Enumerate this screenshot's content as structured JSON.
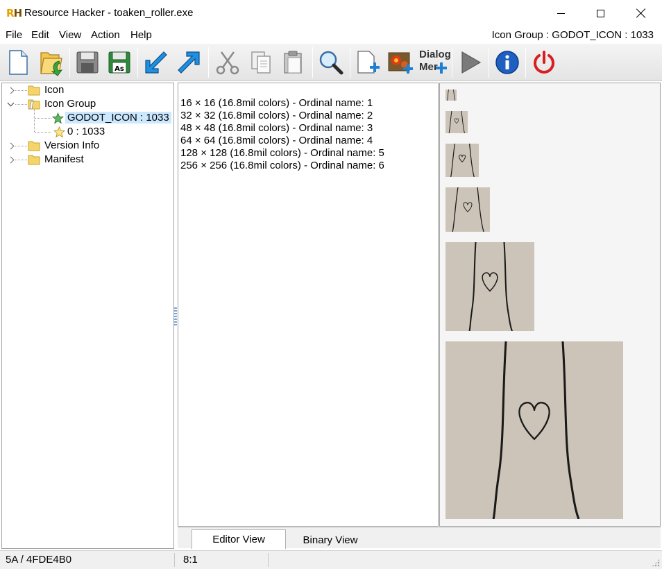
{
  "window": {
    "logo_text": "RH",
    "title": "Resource Hacker - toaken_roller.exe"
  },
  "menu": {
    "items": [
      "File",
      "Edit",
      "View",
      "Action",
      "Help"
    ],
    "status": "Icon Group : GODOT_ICON : 1033"
  },
  "toolbar": {
    "dialog_menu_label_1": "Dialog",
    "dialog_menu_label_2": "Mer"
  },
  "tree": {
    "nodes": [
      {
        "label": "Icon",
        "expanded": false
      },
      {
        "label": "Icon Group",
        "expanded": true
      },
      {
        "label": "GODOT_ICON : 1033",
        "selected": true
      },
      {
        "label": "0 : 1033"
      },
      {
        "label": "Version Info",
        "expanded": false
      },
      {
        "label": "Manifest",
        "expanded": false
      }
    ]
  },
  "resources": {
    "lines": [
      "16 × 16 (16.8mil colors) - Ordinal name: 1",
      "32 × 32 (16.8mil colors) - Ordinal name: 2",
      "48 × 48 (16.8mil colors) - Ordinal name: 3",
      "64 × 64 (16.8mil colors) - Ordinal name: 4",
      "128 × 128 (16.8mil colors) - Ordinal name: 5",
      "256 × 256 (16.8mil colors) - Ordinal name: 6"
    ]
  },
  "tabs": [
    {
      "label": "Editor View",
      "active": true
    },
    {
      "label": "Binary View",
      "active": false
    }
  ],
  "status": {
    "position": "5A / 4FDE4B0",
    "cursor": "8:1"
  },
  "colors": {
    "selection": "#cce8ff",
    "icon_background": "#cdc4b9",
    "folder": "#f5d56a"
  }
}
